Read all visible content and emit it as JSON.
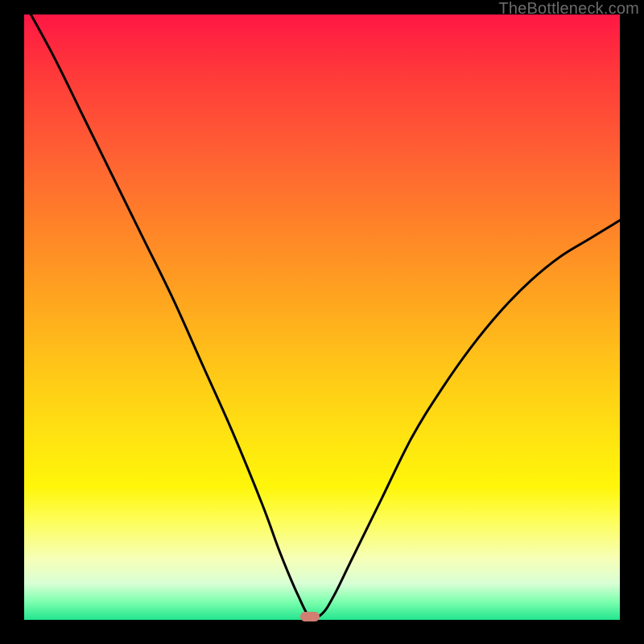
{
  "watermark": "TheBottleneck.com",
  "marker_color": "#d27e72",
  "gradient_stops": [
    {
      "pct": 0,
      "color": "#ff1744"
    },
    {
      "pct": 10,
      "color": "#ff3a3a"
    },
    {
      "pct": 22,
      "color": "#ff5d34"
    },
    {
      "pct": 34,
      "color": "#ff8029"
    },
    {
      "pct": 46,
      "color": "#ffa220"
    },
    {
      "pct": 58,
      "color": "#ffc518"
    },
    {
      "pct": 70,
      "color": "#ffe411"
    },
    {
      "pct": 78,
      "color": "#fff60a"
    },
    {
      "pct": 84,
      "color": "#fdfe5f"
    },
    {
      "pct": 90,
      "color": "#f6ffb8"
    },
    {
      "pct": 94,
      "color": "#d9ffd5"
    },
    {
      "pct": 97,
      "color": "#7dffae"
    },
    {
      "pct": 100,
      "color": "#23e58e"
    }
  ],
  "chart_data": {
    "type": "line",
    "title": "",
    "xlabel": "",
    "ylabel": "",
    "xlim": [
      0,
      100
    ],
    "ylim": [
      0,
      100
    ],
    "grid": false,
    "legend": "none",
    "annotations": [
      {
        "type": "marker",
        "x": 48,
        "y": 0.5,
        "shape": "pill",
        "color": "#d27e72"
      }
    ],
    "series": [
      {
        "name": "bottleneck-curve",
        "x": [
          0,
          5,
          10,
          15,
          20,
          25,
          30,
          35,
          40,
          43,
          46,
          48,
          50,
          52,
          55,
          60,
          65,
          70,
          75,
          80,
          85,
          90,
          95,
          100
        ],
        "values": [
          102,
          93,
          83,
          73,
          63,
          53,
          42,
          31,
          19,
          11,
          4,
          0.5,
          1,
          4,
          10,
          20,
          30,
          38,
          45,
          51,
          56,
          60,
          63,
          66
        ]
      }
    ]
  }
}
